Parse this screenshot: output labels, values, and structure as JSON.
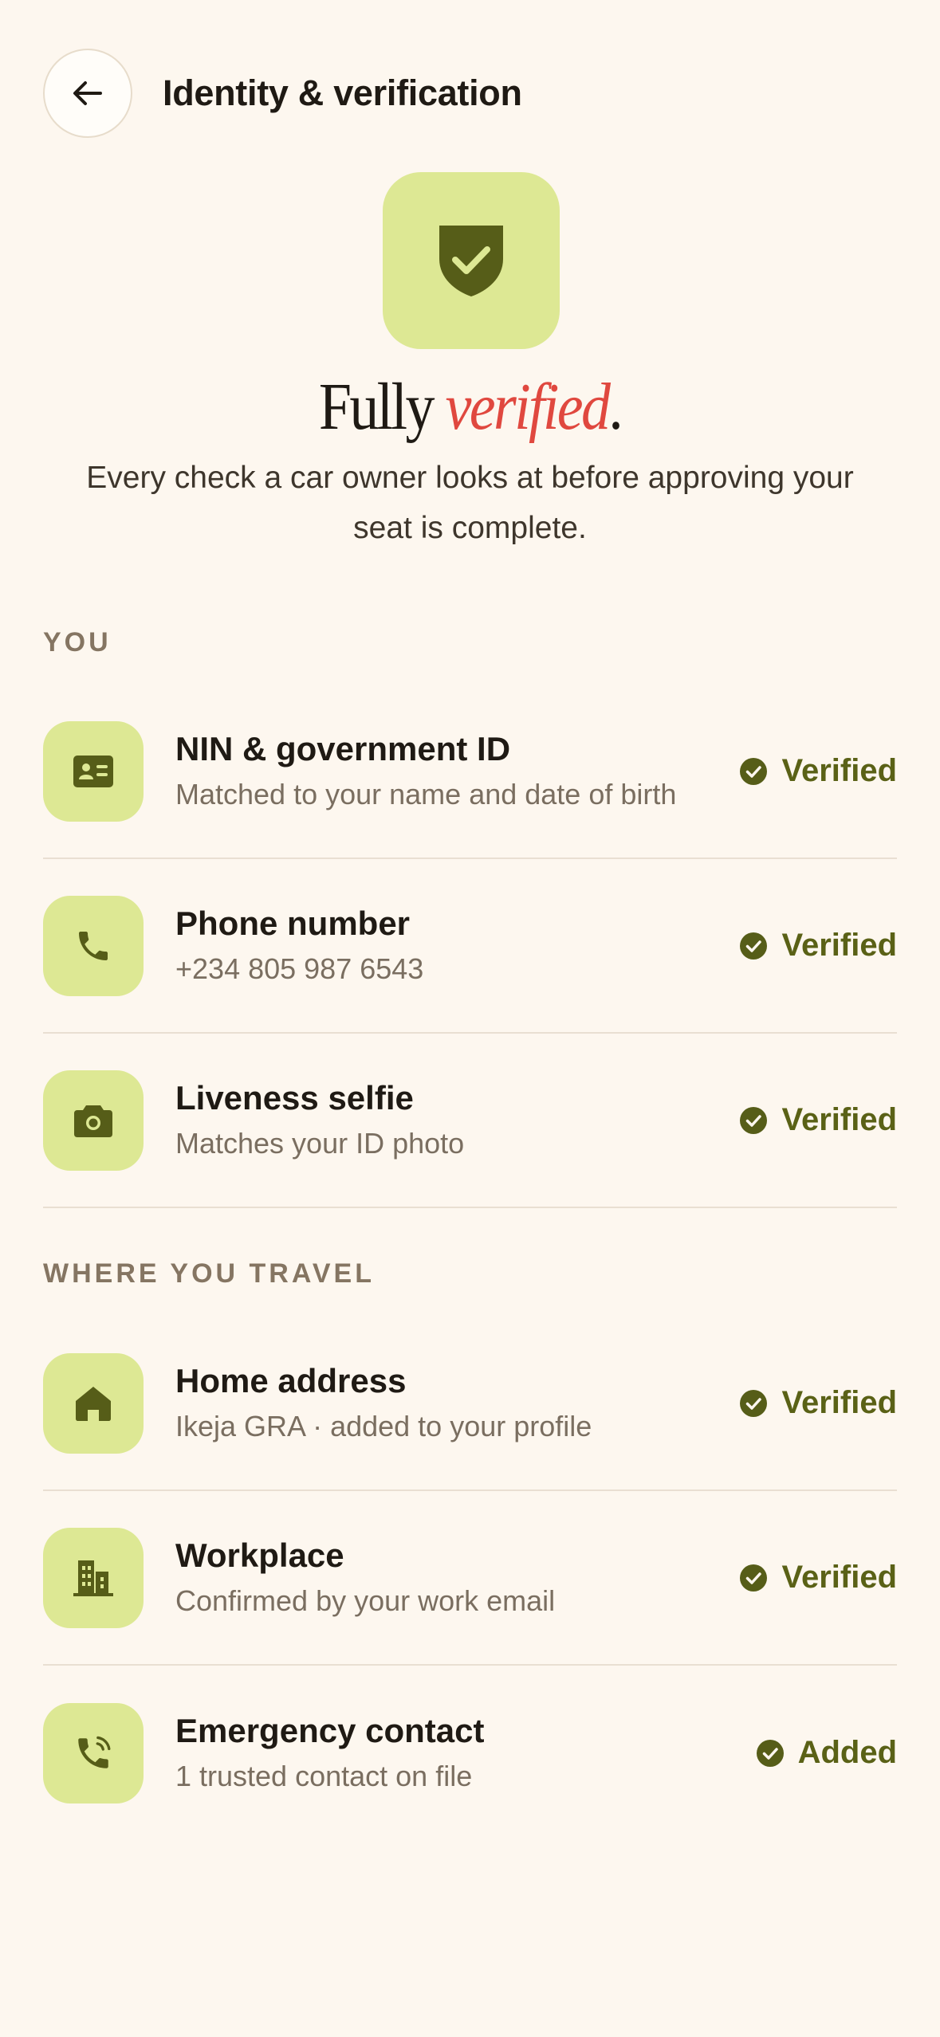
{
  "header": {
    "title": "Identity & verification"
  },
  "hero": {
    "title_plain": "Fully ",
    "title_accent": "verified",
    "title_end": ".",
    "subtitle": "Every check a car owner looks at before approving your seat is complete."
  },
  "sections": [
    {
      "label": "YOU",
      "items": [
        {
          "title": "NIN & government ID",
          "subtitle": "Matched to your name and date of birth",
          "status": "Verified",
          "icon": "id-card-icon"
        },
        {
          "title": "Phone number",
          "subtitle": "+234 805 987 6543",
          "status": "Verified",
          "icon": "phone-icon"
        },
        {
          "title": "Liveness selfie",
          "subtitle": "Matches your ID photo",
          "status": "Verified",
          "icon": "camera-icon"
        }
      ]
    },
    {
      "label": "WHERE YOU TRAVEL",
      "items": [
        {
          "title": "Home address",
          "subtitle": "Ikeja GRA · added to your profile",
          "status": "Verified",
          "icon": "home-icon"
        },
        {
          "title": "Workplace",
          "subtitle": "Confirmed by your work email",
          "status": "Verified",
          "icon": "building-icon"
        },
        {
          "title": "Emergency contact",
          "subtitle": "1 trusted contact on file",
          "status": "Added",
          "icon": "phone-ringing-icon"
        }
      ]
    }
  ],
  "colors": {
    "background": "#fdf7ef",
    "icon_tile": "#dde894",
    "icon_dark": "#565d18",
    "status_green": "#5a6116",
    "accent_red": "#e0483f"
  }
}
